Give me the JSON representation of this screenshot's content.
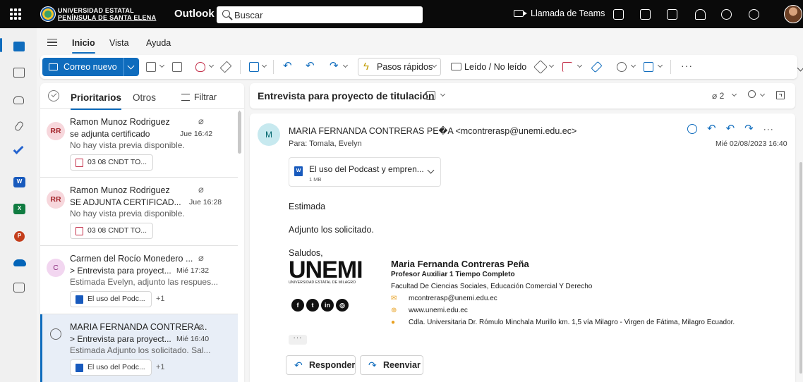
{
  "header": {
    "university_line1": "UNIVERSIDAD ESTATAL",
    "university_line2": "PENÍNSULA DE SANTA ELENA",
    "app_name": "Outlook",
    "search_placeholder": "Buscar",
    "teams_label": "Llamada de Teams"
  },
  "ribbon_tabs": [
    "Inicio",
    "Vista",
    "Ayuda"
  ],
  "ribbon": {
    "new_mail": "Correo nuevo",
    "quick_steps": "Pasos rápidos",
    "read_unread": "Leído / No leído",
    "more": "···"
  },
  "list": {
    "tab_focused": "Prioritarios",
    "tab_other": "Otros",
    "filter": "Filtrar",
    "items": [
      {
        "initials": "RR",
        "sender": "Ramon Munoz Rodriguez",
        "subject": "se adjunta certificado",
        "date": "Jue 16:42",
        "preview": "No hay vista previa disponible.",
        "attachment": "03 08 CNDT TO..."
      },
      {
        "initials": "RR",
        "sender": "Ramon Munoz Rodriguez",
        "subject": "SE ADJUNTA CERTIFICAD...",
        "date": "Jue 16:28",
        "preview": "No hay vista previa disponible.",
        "attachment": "03 08 CNDT TO..."
      },
      {
        "initials": "C",
        "sender": "Carmen del Rocío Monedero ...",
        "subject": "> Entrevista para proyect...",
        "date": "Mié 17:32",
        "preview": "Estimada Evelyn, adjunto las respues...",
        "attachment": "El uso del Podc...",
        "extra": "+1"
      },
      {
        "initials": "",
        "sender": "MARIA FERNANDA CONTRERA...",
        "subject": "> Entrevista para proyect...",
        "date": "Mié 16:40",
        "preview": "Estimada Adjunto los solicitado. Sal...",
        "attachment": "El uso del Podc...",
        "extra": "+1"
      }
    ]
  },
  "reading": {
    "title": "Entrevista para proyecto de titulación",
    "attachment_count": "2",
    "sender_initial": "M",
    "from": "MARIA FERNANDA CONTRERAS PE�A <mcontrerasp@unemi.edu.ec>",
    "to": "Para:  Tomala, Evelyn",
    "date": "Mié 02/08/2023 16:40",
    "attachment_name": "El uso del Podcast y empren...",
    "attachment_size": "1 MB",
    "attachment_type": "W",
    "greeting": "Estimada",
    "body": "Adjunto los solicitado.",
    "closing": "Saludos,",
    "ellipsis": "···",
    "reply": "Responder",
    "forward": "Reenviar"
  },
  "signature": {
    "logo_text": "UNEMI",
    "logo_sub": "UNIVERSIDAD ESTATAL DE MILAGRO",
    "name": "Maria Fernanda Contreras Peña",
    "role": "Profesor Auxiliar 1 Tiempo Completo",
    "faculty": "Facultad De Ciencias Sociales, Educación Comercial Y Derecho",
    "email": "mcontrerasp@unemi.edu.ec",
    "web": "www.unemi.edu.ec",
    "address": "Cdla. Universitaria Dr. Rómulo Minchala Murillo km. 1,5 vía Milagro - Virgen de Fátima, Milagro Ecuador."
  },
  "colors": {
    "accent": "#0f6cbd",
    "topbar": "#0a0a0a"
  }
}
